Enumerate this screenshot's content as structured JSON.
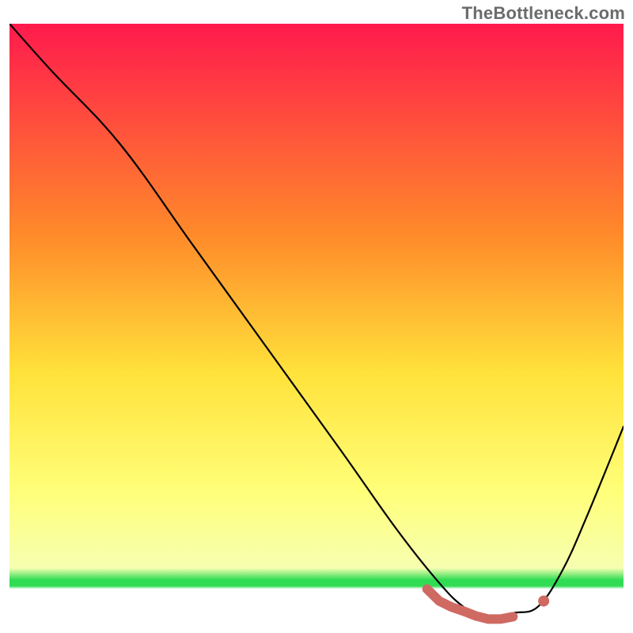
{
  "attribution": "TheBottleneck.com",
  "chart_data": {
    "type": "line",
    "title": "",
    "xlabel": "",
    "ylabel": "",
    "xlim": [
      0,
      100
    ],
    "ylim": [
      0,
      100
    ],
    "grid": false,
    "legend": false,
    "background_gradient": {
      "top": "#ff1a4d",
      "mid_upper": "#ff8a2a",
      "mid": "#ffe23a",
      "low": "#ffff7a",
      "thin_green": "#2fdc53",
      "bottom_white": "#ffffff"
    },
    "gradient_stops_y_percent": [
      0,
      35,
      58,
      78,
      90.5,
      92.5,
      93.5,
      100
    ],
    "series": [
      {
        "name": "bottleneck-curve",
        "x": [
          0,
          7,
          18,
          30,
          42,
          54,
          63,
          70,
          74,
          78,
          82,
          86,
          90,
          94,
          100
        ],
        "y": [
          100,
          92,
          80,
          63,
          46,
          29,
          16,
          7,
          3,
          1,
          2,
          3,
          9,
          18,
          33
        ]
      }
    ],
    "markers": [
      {
        "name": "highlight-run",
        "kind": "segment",
        "x": [
          68,
          70,
          72,
          74,
          76,
          78,
          80,
          82
        ],
        "y": [
          6,
          4,
          3,
          2.3,
          1.5,
          1,
          1,
          1.4
        ],
        "color": "#cf6a63"
      },
      {
        "name": "highlight-dot",
        "kind": "dot",
        "x": 87,
        "y": 4,
        "color": "#cf6a63"
      }
    ]
  }
}
